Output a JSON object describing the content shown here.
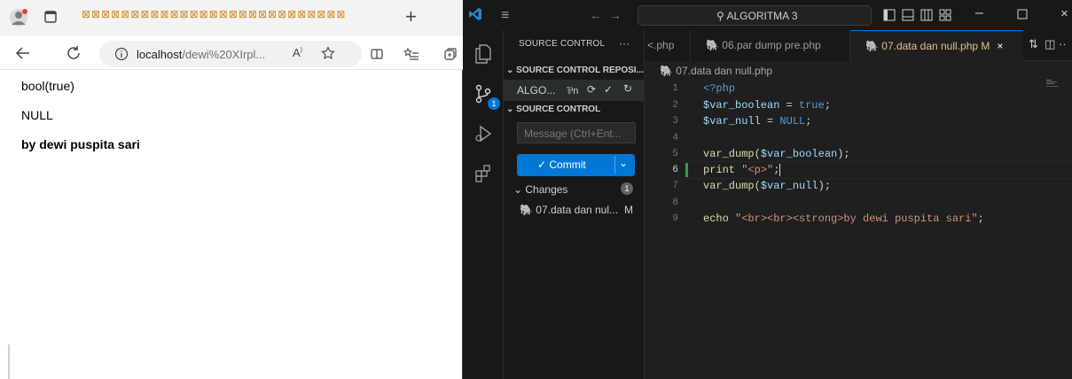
{
  "browser": {
    "tab_title": "⊠⊠⊠⊠⊠⊠⊠⊠⊠⊠⊠⊠⊠⊠⊠⊠⊠⊠⊠⊠⊠⊠⊠⊠⊠⊠⊠",
    "new_tab": "+",
    "url_prefix": "localhost",
    "url_rest": "/dewi%20XIrpl...",
    "page_lines": [
      "bool(true)",
      "NULL",
      "by dewi puspita sari"
    ]
  },
  "vscode": {
    "search_label": "ALGORITMA 3",
    "sidebar": {
      "header": "SOURCE CONTROL",
      "dots": "···",
      "repos_section": "SOURCE CONTROL REPOSI...",
      "repo_name": "ALGO...",
      "repo_branch": "⅌n",
      "sc_section": "SOURCE CONTROL",
      "message_placeholder": "Message (Ctrl+Ent...",
      "commit_label": "Commit",
      "changes_label": "Changes",
      "changes_count": "1",
      "file_name": "07.data dan nul...",
      "file_status": "M",
      "scm_badge": "1"
    },
    "tabs": [
      {
        "label": "<.php"
      },
      {
        "label": "06.par dump pre.php"
      },
      {
        "label": "07.data dan null.php",
        "status": "M"
      }
    ],
    "breadcrumb": "07.data dan null.php",
    "code_lines": [
      "1",
      "2",
      "3",
      "4",
      "5",
      "6",
      "7",
      "8",
      "9"
    ]
  },
  "colors": {
    "accent": "#0078d4",
    "modified": "#2ea043",
    "php_icon": "#a07aa6"
  }
}
